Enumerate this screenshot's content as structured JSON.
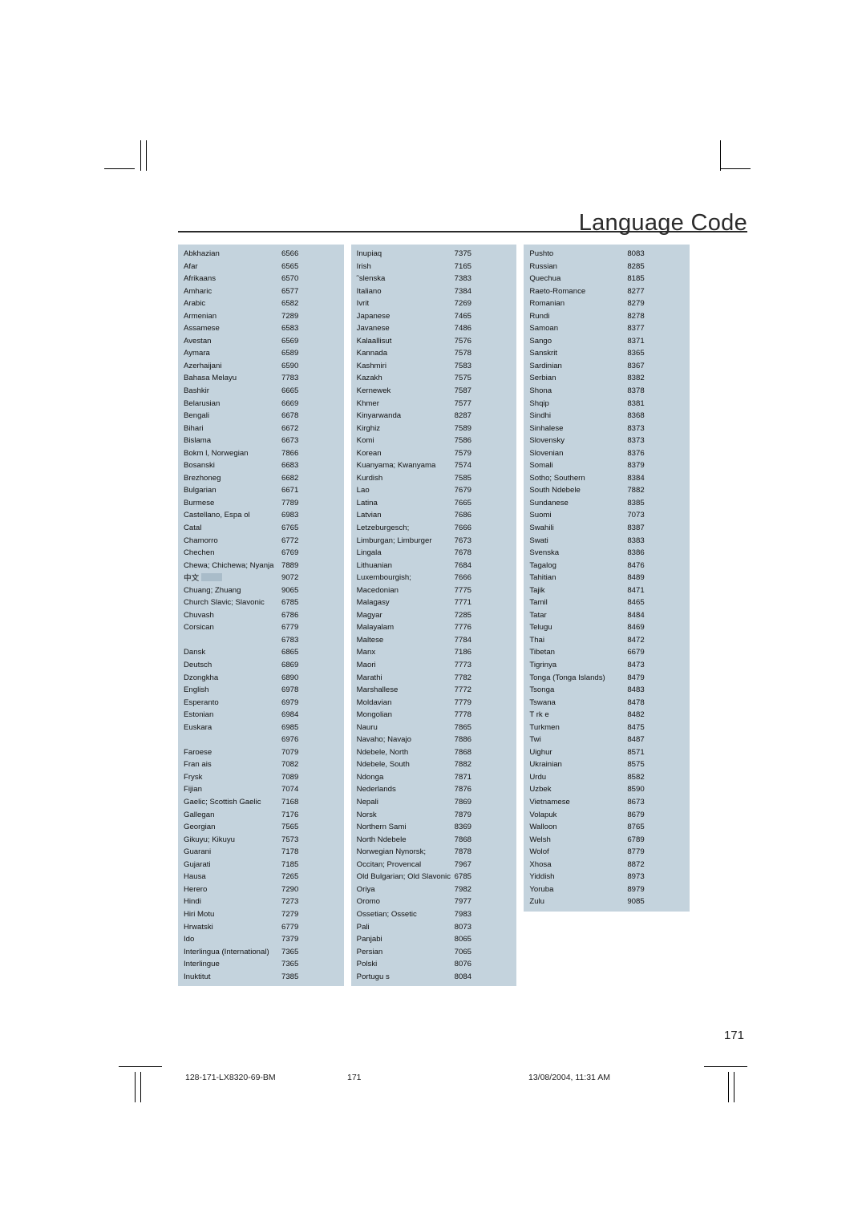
{
  "header": {
    "title": "Language Code"
  },
  "page_number": "171",
  "footer": {
    "left": "128-171-LX8320-69-BM",
    "middle": "171",
    "right": "13/08/2004, 11:31 AM"
  },
  "table": {
    "columns": [
      {
        "id": "column-1",
        "rows": [
          [
            "Abkhazian",
            "6566"
          ],
          [
            "Afar",
            "6565"
          ],
          [
            "Afrikaans",
            "6570"
          ],
          [
            "Amharic",
            "6577"
          ],
          [
            "Arabic",
            "6582"
          ],
          [
            "Armenian",
            "7289"
          ],
          [
            "Assamese",
            "6583"
          ],
          [
            "Avestan",
            "6569"
          ],
          [
            "Aymara",
            "6589"
          ],
          [
            "Azerhaijani",
            "6590"
          ],
          [
            "Bahasa Melayu",
            "7783"
          ],
          [
            "Bashkir",
            "6665"
          ],
          [
            "Belarusian",
            "6669"
          ],
          [
            "Bengali",
            "6678"
          ],
          [
            "Bihari",
            "6672"
          ],
          [
            "Bislama",
            "6673"
          ],
          [
            "Bokm l, Norwegian",
            "7866"
          ],
          [
            "Bosanski",
            "6683"
          ],
          [
            "Brezhoneg",
            "6682"
          ],
          [
            "Bulgarian",
            "6671"
          ],
          [
            "Burmese",
            "7789"
          ],
          [
            "Castellano, Espa ol",
            "6983"
          ],
          [
            "Catal",
            "6765"
          ],
          [
            "Chamorro",
            "6772"
          ],
          [
            "Chechen",
            "6769"
          ],
          [
            "Chewa; Chichewa; Nyanja",
            "7889"
          ],
          [
            "中文",
            "9072"
          ],
          [
            "Chuang; Zhuang",
            "9065"
          ],
          [
            "Church Slavic; Slavonic",
            "6785"
          ],
          [
            "Chuvash",
            "6786"
          ],
          [
            "Corsican",
            "6779"
          ],
          [
            "",
            "6783"
          ],
          [
            "Dansk",
            "6865"
          ],
          [
            "Deutsch",
            "6869"
          ],
          [
            "Dzongkha",
            "6890"
          ],
          [
            "English",
            "6978"
          ],
          [
            "Esperanto",
            "6979"
          ],
          [
            "Estonian",
            "6984"
          ],
          [
            "Euskara",
            "6985"
          ],
          [
            "",
            "6976"
          ],
          [
            "Faroese",
            "7079"
          ],
          [
            "Fran ais",
            "7082"
          ],
          [
            "Frysk",
            "7089"
          ],
          [
            "Fijian",
            "7074"
          ],
          [
            "Gaelic; Scottish Gaelic",
            "7168"
          ],
          [
            "Gallegan",
            "7176"
          ],
          [
            "Georgian",
            "7565"
          ],
          [
            "Gikuyu; Kikuyu",
            "7573"
          ],
          [
            "Guarani",
            "7178"
          ],
          [
            "Gujarati",
            "7185"
          ],
          [
            "Hausa",
            "7265"
          ],
          [
            "Herero",
            "7290"
          ],
          [
            "Hindi",
            "7273"
          ],
          [
            "Hiri Motu",
            "7279"
          ],
          [
            "Hrwatski",
            "6779"
          ],
          [
            "Ido",
            "7379"
          ],
          [
            "Interlingua (International)",
            "7365"
          ],
          [
            "Interlingue",
            "7365"
          ],
          [
            "Inuktitut",
            "7385"
          ]
        ]
      },
      {
        "id": "column-2",
        "rows": [
          [
            "Inupiaq",
            "7375"
          ],
          [
            "Irish",
            "7165"
          ],
          [
            "˜slenska",
            "7383"
          ],
          [
            "Italiano",
            "7384"
          ],
          [
            "Ivrit",
            "7269"
          ],
          [
            "Japanese",
            "7465"
          ],
          [
            "Javanese",
            "7486"
          ],
          [
            "Kalaallisut",
            "7576"
          ],
          [
            "Kannada",
            "7578"
          ],
          [
            "Kashmiri",
            "7583"
          ],
          [
            "Kazakh",
            "7575"
          ],
          [
            "Kernewek",
            "7587"
          ],
          [
            "Khmer",
            "7577"
          ],
          [
            "Kinyarwanda",
            "8287"
          ],
          [
            "Kirghiz",
            "7589"
          ],
          [
            "Komi",
            "7586"
          ],
          [
            "Korean",
            "7579"
          ],
          [
            "Kuanyama; Kwanyama",
            "7574"
          ],
          [
            "Kurdish",
            "7585"
          ],
          [
            "Lao",
            "7679"
          ],
          [
            "Latina",
            "7665"
          ],
          [
            "Latvian",
            "7686"
          ],
          [
            "Letzeburgesch;",
            "7666"
          ],
          [
            "Limburgan; Limburger",
            "7673"
          ],
          [
            "Lingala",
            "7678"
          ],
          [
            "Lithuanian",
            "7684"
          ],
          [
            "Luxembourgish;",
            "7666"
          ],
          [
            "Macedonian",
            "7775"
          ],
          [
            "Malagasy",
            "7771"
          ],
          [
            "Magyar",
            "7285"
          ],
          [
            "Malayalam",
            "7776"
          ],
          [
            "Maltese",
            "7784"
          ],
          [
            "Manx",
            "7186"
          ],
          [
            "Maori",
            "7773"
          ],
          [
            "Marathi",
            "7782"
          ],
          [
            "Marshallese",
            "7772"
          ],
          [
            "Moldavian",
            "7779"
          ],
          [
            "Mongolian",
            "7778"
          ],
          [
            "Nauru",
            "7865"
          ],
          [
            "Navaho; Navajo",
            "7886"
          ],
          [
            "Ndebele, North",
            "7868"
          ],
          [
            "Ndebele, South",
            "7882"
          ],
          [
            "Ndonga",
            "7871"
          ],
          [
            "Nederlands",
            "7876"
          ],
          [
            "Nepali",
            "7869"
          ],
          [
            "Norsk",
            "7879"
          ],
          [
            "Northern Sami",
            "8369"
          ],
          [
            "North Ndebele",
            "7868"
          ],
          [
            "Norwegian Nynorsk;",
            "7878"
          ],
          [
            "Occitan; Provencal",
            "7967"
          ],
          [
            "Old Bulgarian; Old Slavonic",
            "6785"
          ],
          [
            "Oriya",
            "7982"
          ],
          [
            "Oromo",
            "7977"
          ],
          [
            "Ossetian; Ossetic",
            "7983"
          ],
          [
            "Pali",
            "8073"
          ],
          [
            "Panjabi",
            "8065"
          ],
          [
            "Persian",
            "7065"
          ],
          [
            "Polski",
            "8076"
          ],
          [
            "Portugu s",
            "8084"
          ]
        ]
      },
      {
        "id": "column-3",
        "rows": [
          [
            "Pushto",
            "8083"
          ],
          [
            "Russian",
            "8285"
          ],
          [
            "Quechua",
            "8185"
          ],
          [
            "Raeto-Romance",
            "8277"
          ],
          [
            "Romanian",
            "8279"
          ],
          [
            "Rundi",
            "8278"
          ],
          [
            "Samoan",
            "8377"
          ],
          [
            "Sango",
            "8371"
          ],
          [
            "Sanskrit",
            "8365"
          ],
          [
            "Sardinian",
            "8367"
          ],
          [
            "Serbian",
            "8382"
          ],
          [
            "Shona",
            "8378"
          ],
          [
            "Shqip",
            "8381"
          ],
          [
            "Sindhi",
            "8368"
          ],
          [
            "Sinhalese",
            "8373"
          ],
          [
            "Slovensky",
            "8373"
          ],
          [
            "Slovenian",
            "8376"
          ],
          [
            "Somali",
            "8379"
          ],
          [
            "Sotho; Southern",
            "8384"
          ],
          [
            "South Ndebele",
            "7882"
          ],
          [
            "Sundanese",
            "8385"
          ],
          [
            "Suomi",
            "7073"
          ],
          [
            "Swahili",
            "8387"
          ],
          [
            "Swati",
            "8383"
          ],
          [
            "Svenska",
            "8386"
          ],
          [
            "Tagalog",
            "8476"
          ],
          [
            "Tahitian",
            "8489"
          ],
          [
            "Tajik",
            "8471"
          ],
          [
            "Tamil",
            "8465"
          ],
          [
            "Tatar",
            "8484"
          ],
          [
            "Telugu",
            "8469"
          ],
          [
            "Thai",
            "8472"
          ],
          [
            "Tibetan",
            "6679"
          ],
          [
            "Tigrinya",
            "8473"
          ],
          [
            "Tonga (Tonga Islands)",
            "8479"
          ],
          [
            "Tsonga",
            "8483"
          ],
          [
            "Tswana",
            "8478"
          ],
          [
            "T rk e",
            "8482"
          ],
          [
            "Turkmen",
            "8475"
          ],
          [
            "Twi",
            "8487"
          ],
          [
            "Uighur",
            "8571"
          ],
          [
            "Ukrainian",
            "8575"
          ],
          [
            "Urdu",
            "8582"
          ],
          [
            "Uzbek",
            "8590"
          ],
          [
            "Vietnamese",
            "8673"
          ],
          [
            "Volapuk",
            "8679"
          ],
          [
            "Walloon",
            "8765"
          ],
          [
            "Welsh",
            "6789"
          ],
          [
            "Wolof",
            "8779"
          ],
          [
            "Xhosa",
            "8872"
          ],
          [
            "Yiddish",
            "8973"
          ],
          [
            "Yoruba",
            "8979"
          ],
          [
            "Zulu",
            "9085"
          ]
        ]
      }
    ]
  }
}
